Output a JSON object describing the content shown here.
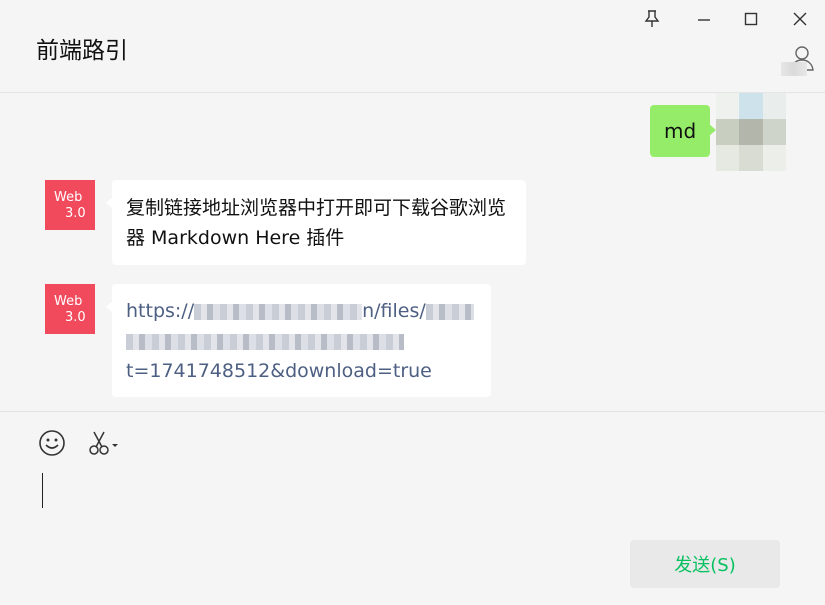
{
  "window": {
    "title": "前端路引",
    "controls": {
      "pin": "pin-icon",
      "minimize": "minimize-icon",
      "maximize": "maximize-icon",
      "close": "close-icon"
    }
  },
  "messages": [
    {
      "side": "right",
      "text": "md"
    },
    {
      "side": "left",
      "avatar_line1": "Web",
      "avatar_line2": "3.0",
      "text": "复制链接地址浏览器中打开即可下载谷歌浏览器 Markdown Here 插件"
    },
    {
      "side": "left",
      "avatar_line1": "Web",
      "avatar_line2": "3.0",
      "link_start": "https://",
      "link_mid": "n/files/",
      "link_end": "t=1741748512&download=true"
    }
  ],
  "toolbar": {
    "emoji": "emoji-icon",
    "screenshot": "scissors-icon"
  },
  "send_button": {
    "label": "发送(S)"
  },
  "colors": {
    "accent_green": "#07c160",
    "bubble_green": "#95ec69",
    "avatar_red": "#f24a5d",
    "link": "#4d5f82"
  }
}
